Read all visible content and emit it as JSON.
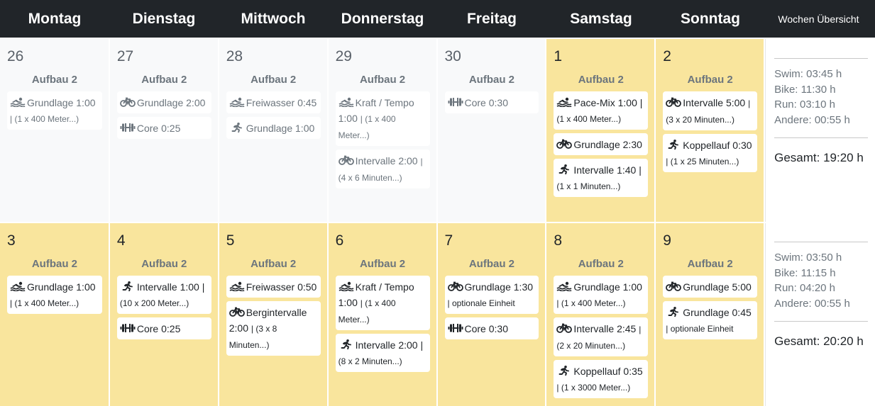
{
  "header": {
    "days": [
      "Montag",
      "Dienstag",
      "Mittwoch",
      "Donnerstag",
      "Freitag",
      "Samstag",
      "Sonntag"
    ],
    "summary_label": "Wochen Übersicht"
  },
  "colors": {
    "header_bg": "#212529",
    "past_day_bg": "#f8f9fa",
    "current_day_bg": "#f9e59d",
    "card_bg": "#ffffff",
    "muted_text": "#6c757d"
  },
  "weeks": [
    {
      "days": [
        {
          "date": "26",
          "state": "past",
          "phase": "Aufbau 2",
          "workouts": [
            {
              "sport": "swim",
              "title": "Grundlage 1:00",
              "detail": "| (1 x 400 Meter...)"
            }
          ]
        },
        {
          "date": "27",
          "state": "past",
          "phase": "Aufbau 2",
          "workouts": [
            {
              "sport": "bike",
              "title": "Grundlage 2:00",
              "detail": ""
            },
            {
              "sport": "strength",
              "title": "Core 0:25",
              "detail": ""
            }
          ]
        },
        {
          "date": "28",
          "state": "past",
          "phase": "Aufbau 2",
          "workouts": [
            {
              "sport": "swim",
              "title": "Freiwasser 0:45",
              "detail": ""
            },
            {
              "sport": "run",
              "title": "Grundlage 1:00",
              "detail": ""
            }
          ]
        },
        {
          "date": "29",
          "state": "past",
          "phase": "Aufbau 2",
          "workouts": [
            {
              "sport": "swim",
              "title": "Kraft / Tempo 1:00",
              "detail": "| (1 x 400 Meter...)"
            },
            {
              "sport": "bike",
              "title": "Intervalle 2:00",
              "detail": "| (4 x 6 Minuten...)"
            }
          ]
        },
        {
          "date": "30",
          "state": "past",
          "phase": "Aufbau 2",
          "workouts": [
            {
              "sport": "strength",
              "title": "Core 0:30",
              "detail": ""
            }
          ]
        },
        {
          "date": "1",
          "state": "current",
          "phase": "Aufbau 2",
          "workouts": [
            {
              "sport": "swim",
              "title": "Pace-Mix 1:00 |",
              "detail": "(1 x 400 Meter...)"
            },
            {
              "sport": "bike",
              "title": "Grundlage 2:30",
              "detail": ""
            },
            {
              "sport": "run",
              "title": "Intervalle 1:40 |",
              "detail": "(1 x 1 Minuten...)"
            }
          ]
        },
        {
          "date": "2",
          "state": "current",
          "phase": "Aufbau 2",
          "workouts": [
            {
              "sport": "bike",
              "title": "Intervalle 5:00",
              "detail": "| (3 x 20 Minuten...)"
            },
            {
              "sport": "run",
              "title": "Koppellauf 0:30",
              "detail": "| (1 x 25 Minuten...)"
            }
          ]
        }
      ],
      "summary": {
        "swim": "Swim: 03:45 h",
        "bike": "Bike: 11:30 h",
        "run": "Run: 03:10 h",
        "other": "Andere: 00:55 h",
        "total": "Gesamt: 19:20 h"
      }
    },
    {
      "days": [
        {
          "date": "3",
          "state": "current",
          "phase": "Aufbau 2",
          "workouts": [
            {
              "sport": "swim",
              "title": "Grundlage 1:00",
              "detail": "| (1 x 400 Meter...)"
            }
          ]
        },
        {
          "date": "4",
          "state": "current",
          "phase": "Aufbau 2",
          "workouts": [
            {
              "sport": "run",
              "title": "Intervalle 1:00 |",
              "detail": "(10 x 200 Meter...)"
            },
            {
              "sport": "strength",
              "title": "Core 0:25",
              "detail": ""
            }
          ]
        },
        {
          "date": "5",
          "state": "current",
          "phase": "Aufbau 2",
          "workouts": [
            {
              "sport": "swim",
              "title": "Freiwasser 0:50",
              "detail": ""
            },
            {
              "sport": "bike",
              "title": "Bergintervalle 2:00",
              "detail": "| (3 x 8 Minuten...)"
            }
          ]
        },
        {
          "date": "6",
          "state": "current",
          "phase": "Aufbau 2",
          "workouts": [
            {
              "sport": "swim",
              "title": "Kraft / Tempo 1:00",
              "detail": "| (1 x 400 Meter...)"
            },
            {
              "sport": "run",
              "title": "Intervalle 2:00 |",
              "detail": "(8 x 2 Minuten...)"
            }
          ]
        },
        {
          "date": "7",
          "state": "current",
          "phase": "Aufbau 2",
          "workouts": [
            {
              "sport": "bike",
              "title": "Grundlage 1:30",
              "detail": "| optionale Einheit"
            },
            {
              "sport": "strength",
              "title": "Core 0:30",
              "detail": ""
            }
          ]
        },
        {
          "date": "8",
          "state": "current",
          "phase": "Aufbau 2",
          "workouts": [
            {
              "sport": "swim",
              "title": "Grundlage 1:00",
              "detail": "| (1 x 400 Meter...)"
            },
            {
              "sport": "bike",
              "title": "Intervalle 2:45",
              "detail": "| (2 x 20 Minuten...)"
            },
            {
              "sport": "run",
              "title": "Koppellauf 0:35",
              "detail": "| (1 x 3000 Meter...)"
            }
          ]
        },
        {
          "date": "9",
          "state": "current",
          "phase": "Aufbau 2",
          "workouts": [
            {
              "sport": "bike",
              "title": "Grundlage 5:00",
              "detail": ""
            },
            {
              "sport": "run",
              "title": "Grundlage 0:45",
              "detail": "| optionale Einheit"
            }
          ]
        }
      ],
      "summary": {
        "swim": "Swim: 03:50 h",
        "bike": "Bike: 11:15 h",
        "run": "Run: 04:20 h",
        "other": "Andere: 00:55 h",
        "total": "Gesamt: 20:20 h"
      }
    }
  ],
  "icons": {
    "swim": "swimmer-icon",
    "bike": "bicycle-icon",
    "run": "runner-icon",
    "strength": "dumbbell-icon"
  }
}
